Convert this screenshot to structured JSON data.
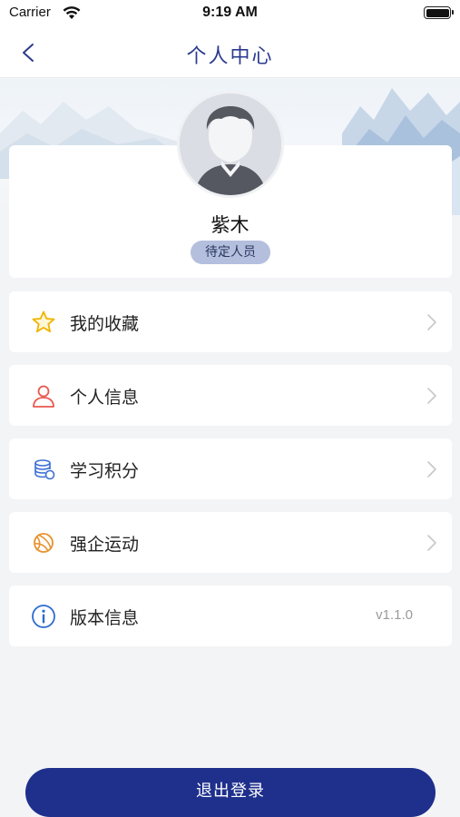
{
  "status_bar": {
    "carrier": "Carrier",
    "time": "9:19 AM"
  },
  "nav": {
    "title": "个人中心",
    "back_icon": "chevron-left-icon"
  },
  "profile": {
    "name": "紫木",
    "role": "待定人员",
    "avatar_icon": "default-user-avatar"
  },
  "menu": [
    {
      "label": "我的收藏",
      "icon": "star-icon",
      "color": "#f0b400"
    },
    {
      "label": "个人信息",
      "icon": "person-icon",
      "color": "#e8584f"
    },
    {
      "label": "学习积分",
      "icon": "coin-stack-icon",
      "color": "#3d6fd4"
    },
    {
      "label": "强企运动",
      "icon": "ball-icon",
      "color": "#e8922f"
    },
    {
      "label": "版本信息",
      "icon": "info-icon",
      "color": "#2d6bd0",
      "value": "v1.1.0"
    }
  ],
  "logout": {
    "label": "退出登录",
    "color": "#1f2f8c"
  },
  "colors": {
    "accent": "#2a3a8f",
    "background": "#f3f4f6",
    "badge": "#b3bfdd"
  }
}
